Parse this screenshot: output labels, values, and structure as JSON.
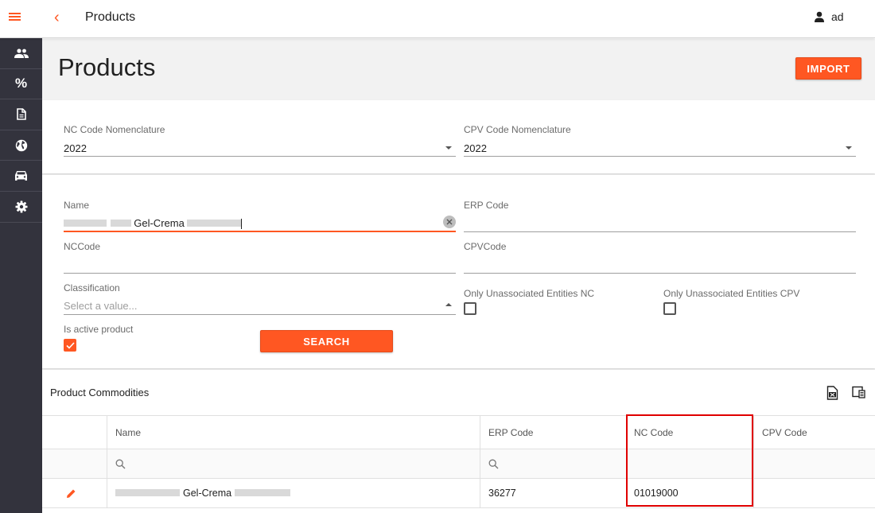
{
  "header": {
    "title": "Products",
    "user_name": "ad"
  },
  "sidebar": {
    "items": [
      {
        "name": "users-icon"
      },
      {
        "name": "percent-icon",
        "glyph": "%"
      },
      {
        "name": "document-icon"
      },
      {
        "name": "globe-icon"
      },
      {
        "name": "car-icon"
      },
      {
        "name": "gear-icon"
      }
    ]
  },
  "page": {
    "title": "Products",
    "import_label": "IMPORT"
  },
  "nomenclature": {
    "nc": {
      "label": "NC Code Nomenclature",
      "value": "2022"
    },
    "cpv": {
      "label": "CPV Code Nomenclature",
      "value": "2022"
    }
  },
  "filters": {
    "name": {
      "label": "Name",
      "value_visible": "Gel-Crema"
    },
    "erp": {
      "label": "ERP Code",
      "value": ""
    },
    "nccode": {
      "label": "NCCode",
      "value": ""
    },
    "cpvcode": {
      "label": "CPVCode",
      "value": ""
    },
    "classification": {
      "label": "Classification",
      "placeholder": "Select a value..."
    },
    "unassoc_nc": {
      "label": "Only Unassociated Entities NC",
      "checked": false
    },
    "unassoc_cpv": {
      "label": "Only Unassociated Entities CPV",
      "checked": false
    },
    "is_active": {
      "label": "Is active product",
      "checked": true
    },
    "search_label": "SEARCH"
  },
  "grid": {
    "title": "Product Commodities",
    "columns": [
      "Name",
      "ERP Code",
      "NC Code",
      "CPV Code"
    ],
    "rows": [
      {
        "name_visible": "Gel-Crema",
        "erp": "36277",
        "nc": "01019000",
        "cpv": ""
      }
    ]
  },
  "colors": {
    "accent": "#ff5722",
    "sidebar": "#33333d",
    "highlight": "#e00000"
  }
}
